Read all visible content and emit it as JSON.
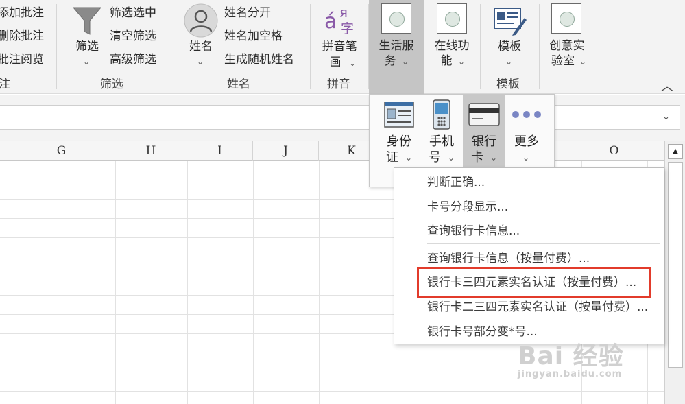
{
  "ribbon": {
    "comment_group": {
      "items": [
        "添加批注",
        "删除批注",
        "批注阅览"
      ],
      "label": "注"
    },
    "filter_group": {
      "big_button": "筛选",
      "items": [
        "筛选选中",
        "清空筛选",
        "高级筛选"
      ],
      "label": "筛选"
    },
    "name_group": {
      "big_button": "姓名",
      "items": [
        "姓名分开",
        "姓名加空格",
        "生成随机姓名"
      ],
      "label": "姓名"
    },
    "pinyin_group": {
      "big_button_line1": "拼音笔",
      "big_button_line2": "画",
      "icon_glyph_a": "á",
      "icon_glyph_ya": "я",
      "icon_glyph_zi": "字",
      "label": "拼音"
    },
    "life_service": {
      "line1": "生活服",
      "line2": "务"
    },
    "online": {
      "line1": "在线功",
      "line2": "能"
    },
    "template": {
      "line1": "模板",
      "label": "模板"
    },
    "creative": {
      "line1": "创意实",
      "line2": "验室"
    }
  },
  "columns": [
    "G",
    "H",
    "I",
    "J",
    "K",
    "O"
  ],
  "submenu": {
    "buttons": [
      {
        "line1": "身份",
        "line2": "证",
        "icon": "id-card-icon"
      },
      {
        "line1": "手机",
        "line2": "号",
        "icon": "mobile-phone-icon"
      },
      {
        "line1": "银行",
        "line2": "卡",
        "icon": "bank-card-icon"
      },
      {
        "line1": "更多",
        "line2": "",
        "icon": "more-dots-icon"
      }
    ]
  },
  "dropdown": {
    "items": [
      "判断正确...",
      "卡号分段显示...",
      "查询银行卡信息...",
      "查询银行卡信息（按量付费）...",
      "银行卡三四元素实名认证（按量付费）...",
      "银行卡二三四元素实名认证（按量付费）...",
      "银行卡号部分变*号..."
    ],
    "highlighted_index": 4
  },
  "watermark": {
    "main": "Bai 经验",
    "sub": "jingyan.baidu.com"
  },
  "colors": {
    "highlight": "#e23b2b",
    "selected_button": "#c8c8c8",
    "ribbon_bg": "#f3f3f3"
  }
}
